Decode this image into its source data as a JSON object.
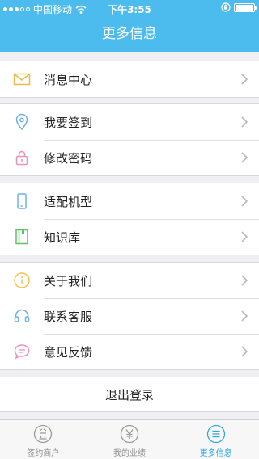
{
  "status_bar": {
    "carrier": "中国移动",
    "time": "下午3:55",
    "battery_level": 1.0
  },
  "header": {
    "title": "更多信息"
  },
  "groups": [
    {
      "items": [
        {
          "label": "消息中心",
          "icon": "envelope-icon",
          "color": "#f3b64d"
        }
      ]
    },
    {
      "items": [
        {
          "label": "我要签到",
          "icon": "location-pin-icon",
          "color": "#6fb0e8"
        },
        {
          "label": "修改密码",
          "icon": "padlock-icon",
          "color": "#ef8fbe"
        }
      ]
    },
    {
      "items": [
        {
          "label": "适配机型",
          "icon": "phone-icon",
          "color": "#6fb0e8"
        },
        {
          "label": "知识库",
          "icon": "book-icon",
          "color": "#5ec266"
        }
      ]
    },
    {
      "items": [
        {
          "label": "关于我们",
          "icon": "info-icon",
          "color": "#f3c24d"
        },
        {
          "label": "联系客服",
          "icon": "headset-icon",
          "color": "#6fb0e8"
        },
        {
          "label": "意见反馈",
          "icon": "feedback-bubble-icon",
          "color": "#ef8fbe"
        }
      ]
    }
  ],
  "logout_label": "退出登录",
  "tabbar": {
    "tabs": [
      {
        "label": "签约商户",
        "icon": "signed-merchant-icon",
        "active": false
      },
      {
        "label": "我的业绩",
        "icon": "yen-coin-icon",
        "active": false
      },
      {
        "label": "更多信息",
        "icon": "more-list-icon",
        "active": true
      }
    ]
  },
  "colors": {
    "header": "#4cbcef",
    "active_tab": "#2fa6e8",
    "inactive_tab": "#8e8e8e"
  }
}
